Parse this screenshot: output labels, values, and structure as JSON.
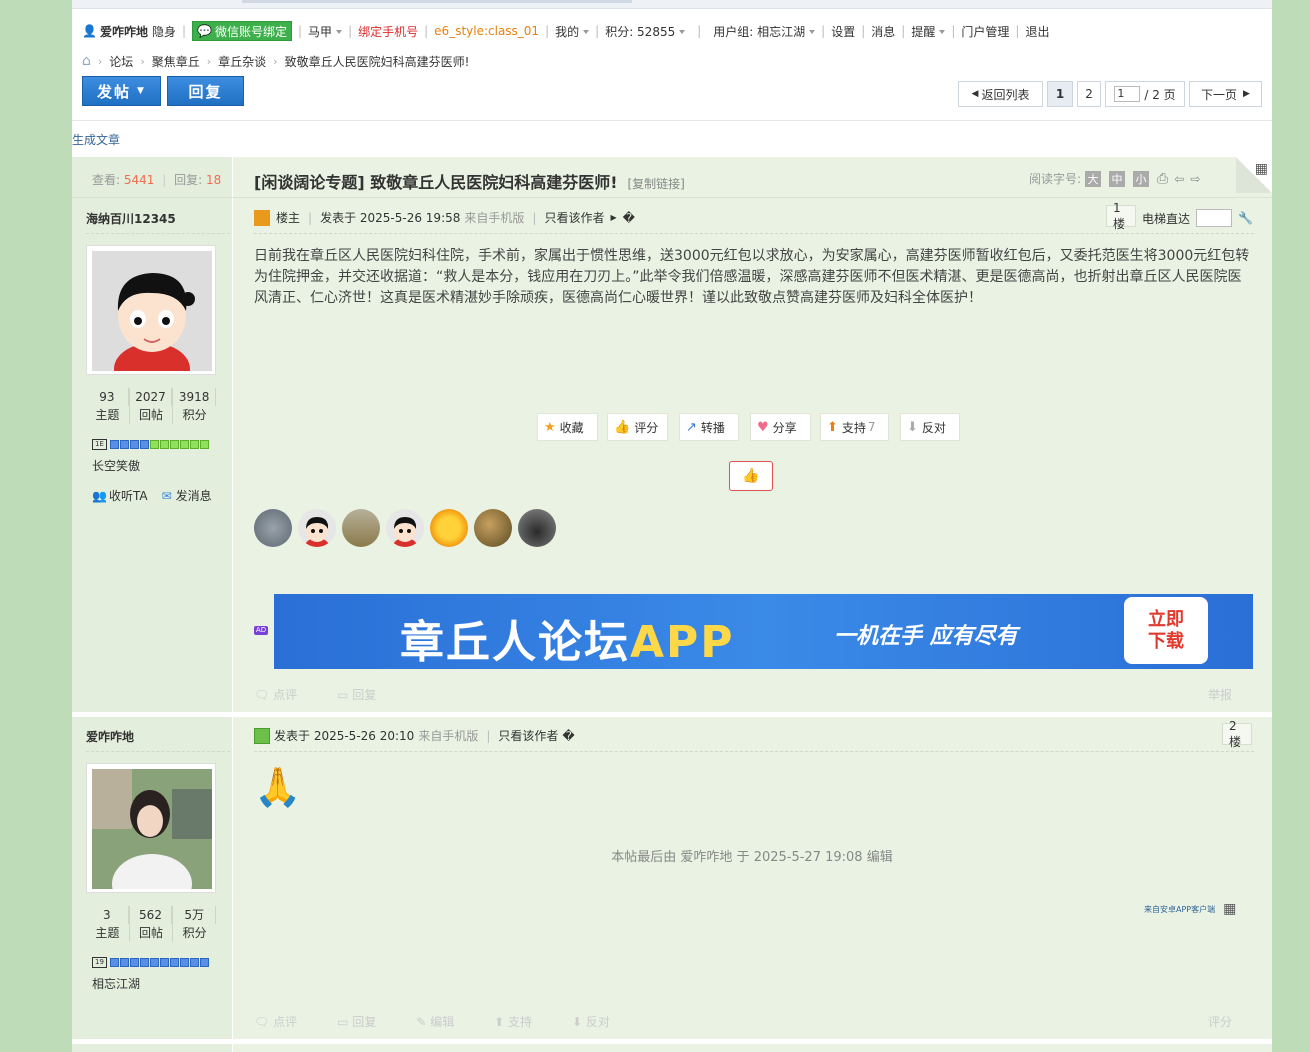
{
  "userbar": {
    "username": "爱咋咋地",
    "invisible": "隐身",
    "wechat_bind": "微信账号绑定",
    "majia": "马甲",
    "bind_phone": "绑定手机号",
    "style": "e6_style:class_01",
    "mine": "我的",
    "points": "积分: 52855",
    "usergroup": "用户组: 相忘江湖",
    "settings": "设置",
    "messages": "消息",
    "remind": "提醒",
    "portal": "门户管理",
    "logout": "退出"
  },
  "breadcrumb": [
    "论坛",
    "聚焦章丘",
    "章丘杂谈",
    "致敬章丘人民医院妇科高建芬医师!"
  ],
  "actions": {
    "post": "发帖",
    "reply": "回复"
  },
  "pager": {
    "back": "返回列表",
    "page1": "1",
    "page2": "2",
    "input": "1",
    "total": "/ 2 页",
    "next": "下一页"
  },
  "gen_article": "生成文章",
  "thread": {
    "views_label": "查看:",
    "views": "5441",
    "replies_label": "回复:",
    "replies": "18",
    "title": "[闲谈阔论专题] 致敬章丘人民医院妇科高建芬医师!",
    "copy_link": "[复制链接]",
    "read_size_label": "阅读字号:",
    "size_big": "大",
    "size_mid": "中",
    "size_small": "小"
  },
  "post1": {
    "author": "海纳百川12345",
    "stats": [
      {
        "num": "93",
        "label": "主题"
      },
      {
        "num": "2027",
        "label": "回帖"
      },
      {
        "num": "3918",
        "label": "积分"
      }
    ],
    "level_badge": "1E",
    "rank": "长空笑傲",
    "follow": "收听TA",
    "send_msg": "发消息",
    "owner": "楼主",
    "posted": "发表于 2025-5-26 19:58",
    "from_mobile": "来自手机版",
    "only_author": "只看该作者",
    "trailing": "�",
    "floor": "1楼",
    "elevator": "电梯直达",
    "content": "日前我在章丘区人民医院妇科住院，手术前，家属出于惯性思维，送3000元红包以求放心，为安家属心，高建芬医师暂收红包后，又委托范医生将3000元红包转为住院押金，并交还收据道：“救人是本分，钱应用在刀刃上。”此举令我们倍感温暖，深感高建芬医师不但医术精湛、更是医德高尚，也折射出章丘区人民医院医风清正、仁心济世！这真是医术精湛妙手除顽疾，医德高尚仁心暖世界！谨以此致敬点赞高建芬医师及妇科全体医护！",
    "buttons": {
      "fav": "收藏",
      "rate": "评分",
      "share_repost": "转播",
      "share": "分享",
      "support": "支持",
      "support_count": "7",
      "oppose": "反对"
    },
    "banner_main": "章丘人论坛",
    "banner_app": "APP",
    "banner_slogan": "一机在手 应有尽有",
    "banner_dl1": "立即",
    "banner_dl2": "下载",
    "ad": "AD",
    "comment": "点评",
    "reply": "回复",
    "report": "举报"
  },
  "post2": {
    "author": "爱咋咋地",
    "stats": [
      {
        "num": "3",
        "label": "主题"
      },
      {
        "num": "562",
        "label": "回帖"
      },
      {
        "num": "5万",
        "label": "积分"
      }
    ],
    "level_badge": "19",
    "rank": "相忘江湖",
    "posted": "发表于 2025-5-26 20:10",
    "from_mobile": "来自手机版",
    "only_author": "只看该作者",
    "trailing": "�",
    "floor": "2楼",
    "emoji": "🙏",
    "edit_note": "本帖最后由 爱咋咋地 于 2025-5-27 19:08 编辑",
    "from_app": "来自安卓APP客户端",
    "comment": "点评",
    "reply": "回复",
    "edit": "编辑",
    "support": "支持",
    "oppose": "反对",
    "rate": "评分"
  },
  "colors": {
    "accent": "#1f6fc4",
    "bg_green": "#bfdcb8",
    "post_bg": "#e9f2e3",
    "red": "#f26c4f"
  }
}
